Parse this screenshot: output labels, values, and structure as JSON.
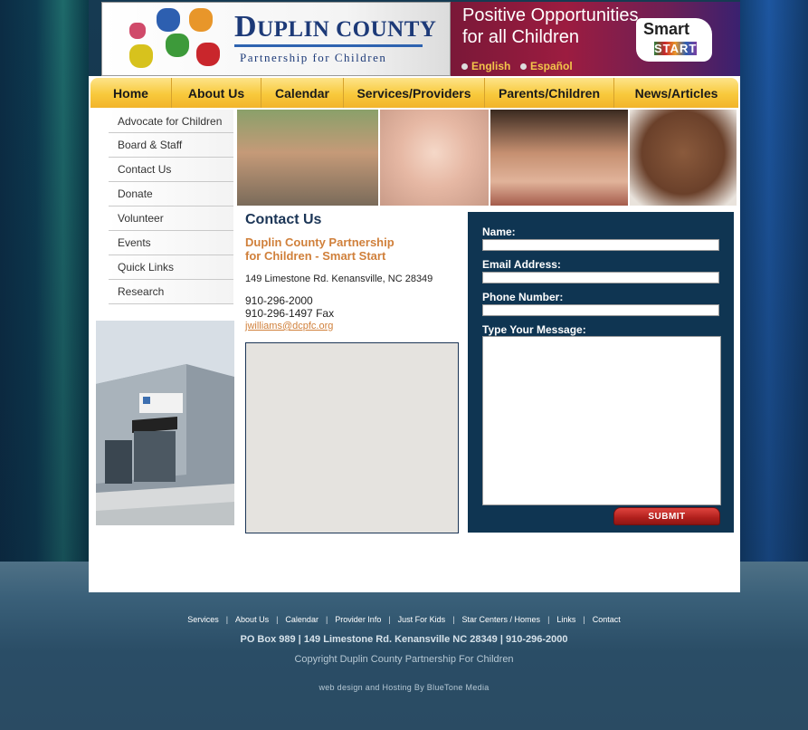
{
  "header": {
    "logo_title_big": "D",
    "logo_title_rest": "UPLIN COUNTY",
    "logo_subtitle": "Partnership for Children",
    "tagline_line1": "Positive Opportunities",
    "tagline_line2": "for all Children",
    "smart_start_word1": "Smart",
    "smart_start_word2": "START",
    "languages": [
      "English",
      "Español"
    ]
  },
  "nav": {
    "items": [
      "Home",
      "About Us",
      "Calendar",
      "Services/Providers",
      "Parents/Children",
      "News/Articles"
    ]
  },
  "sidebar": {
    "items": [
      "Advocate for Children",
      "Board & Staff",
      "Contact Us",
      "Donate",
      "Volunteer",
      "Events",
      "Quick Links",
      "Research"
    ]
  },
  "contact": {
    "title": "Contact Us",
    "org_line1": "Duplin County Partnership",
    "org_line2": "for Children - Smart Start",
    "address": "149 Limestone Rd. Kenansville, NC 28349",
    "phone": "910-296-2000",
    "fax": "910-296-1497 Fax",
    "email": "jwilliams@dcpfc.org"
  },
  "form": {
    "name_label": "Name:",
    "email_label": "Email Address:",
    "phone_label": "Phone Number:",
    "message_label": "Type Your Message:",
    "submit_label": "SUBMIT"
  },
  "footer": {
    "links": [
      "Services",
      "About Us",
      "Calendar",
      "Provider Info",
      "Just For Kids",
      "Star Centers / Homes",
      "Links",
      "Contact"
    ],
    "address": "PO Box 989 | 149 Limestone Rd. Kenansville NC 28349 | 910-296-2000",
    "copyright": "Copyright Duplin County Partnership For Children",
    "design": "web design and Hosting By BlueTone Media"
  },
  "colors": {
    "nav_gold": "#f8c93c",
    "navy": "#0f3552",
    "accent_orange": "#d0803b",
    "banner_red": "#9c1c40"
  }
}
